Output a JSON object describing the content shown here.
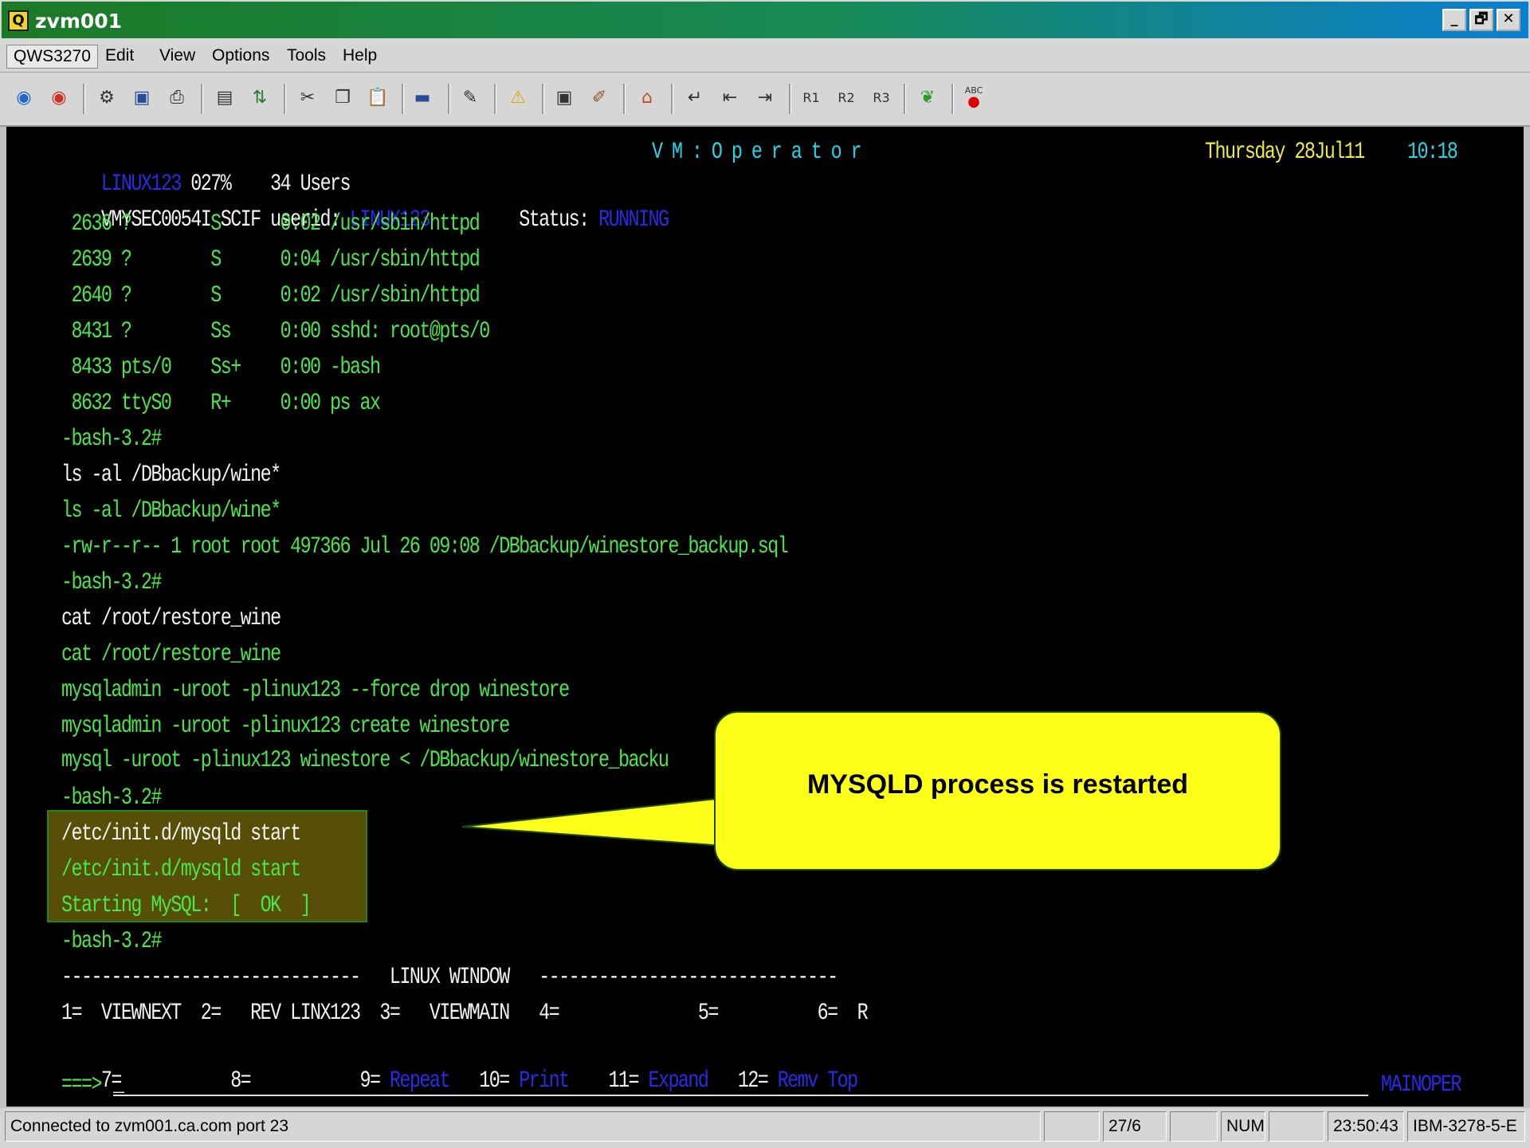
{
  "window": {
    "title": "zvm001",
    "icon": "Q",
    "controls": [
      "_",
      "🗗",
      "✕"
    ]
  },
  "menu": [
    "QWS3270",
    "Edit",
    "View",
    "Options",
    "Tools",
    "Help"
  ],
  "toolbar": {
    "icons": [
      "connect-icon",
      "disconnect-icon",
      "macro-icon",
      "display-icon",
      "printer-icon",
      "capture-icon",
      "transfer-icon",
      "cut-icon",
      "copy-icon",
      "paste-icon",
      "keyboard-icon",
      "settings-icon",
      "warning-icon",
      "monitor-icon",
      "tool-icon",
      "home-icon",
      "enter-icon",
      "tab-left-icon",
      "tab-right-icon",
      "r1-icon",
      "r2-icon",
      "r3-icon",
      "leaf-icon",
      "spell-check-icon"
    ]
  },
  "terminal": {
    "header": {
      "system": "LINUX123",
      "cpu": "027%",
      "users": "34 Users",
      "app_title": "V M : O p e r a t o r",
      "date": "Thursday 28Jul11",
      "time": "10:18"
    },
    "status_line": {
      "prefix": "VMYSEC0054I SCIF userid:",
      "userid": "LINUX123",
      "status_label": "Status:",
      "status_value": "RUNNING"
    },
    "lines": [
      " 2636 ?        S      0:02 /usr/sbin/httpd",
      " 2639 ?        S      0:04 /usr/sbin/httpd",
      " 2640 ?        S      0:02 /usr/sbin/httpd",
      " 8431 ?        Ss     0:00 sshd: root@pts/0",
      " 8433 pts/0    Ss+    0:00 -bash",
      " 8632 ttyS0    R+     0:00 ps ax",
      "-bash-3.2#",
      "ls -al /DBbackup/wine*",
      "ls -al /DBbackup/wine*",
      "-rw-r--r-- 1 root root 497366 Jul 26 09:08 /DBbackup/winestore_backup.sql",
      "-bash-3.2#",
      "cat /root/restore_wine",
      "cat /root/restore_wine",
      "mysqladmin -uroot -plinux123 --force drop winestore",
      "mysqladmin -uroot -plinux123 create winestore",
      "mysql -uroot -plinux123 winestore < /DBbackup/winestore_backu",
      "-bash-3.2#",
      "/etc/init.d/mysqld start",
      "/etc/init.d/mysqld start",
      "Starting MySQL:  [  OK  ]",
      "-bash-3.2#"
    ],
    "window_divider": "------------------------------   LINUX WINDOW   ------------------------------",
    "pf_row1": "1=  VIEWNEXT  2=   REV LINX123  3=   VIEWMAIN   4=              5=          6=  R",
    "pf_row2": {
      "plain": "7=           8=           9= ",
      "k9": "Repeat",
      "k10_label": "   10= ",
      "k10": "Print",
      "k11_label": "    11= ",
      "k11": "Expand",
      "k12_label": "   12= ",
      "k12": "Remv Top"
    },
    "prompt": "===>",
    "prompt_cursor": "_",
    "operator_id": "MAINOPER"
  },
  "callout": {
    "text": "MYSQLD process is restarted",
    "fill": "#ffff1a"
  },
  "statusbar": {
    "connection": "Connected to zvm001.ca.com port 23",
    "cursor": "27/6",
    "numlock": "NUM",
    "clock": "23:50:43",
    "terminal_type": "IBM-3278-5-E"
  },
  "colors": {
    "terminal_bg": "#000000",
    "green_text": "#48e848",
    "white_text": "#f2f2f2",
    "blue_text": "#2a2ae8",
    "cyan_text": "#21d6e8",
    "yellow_text": "#ecec3c"
  }
}
